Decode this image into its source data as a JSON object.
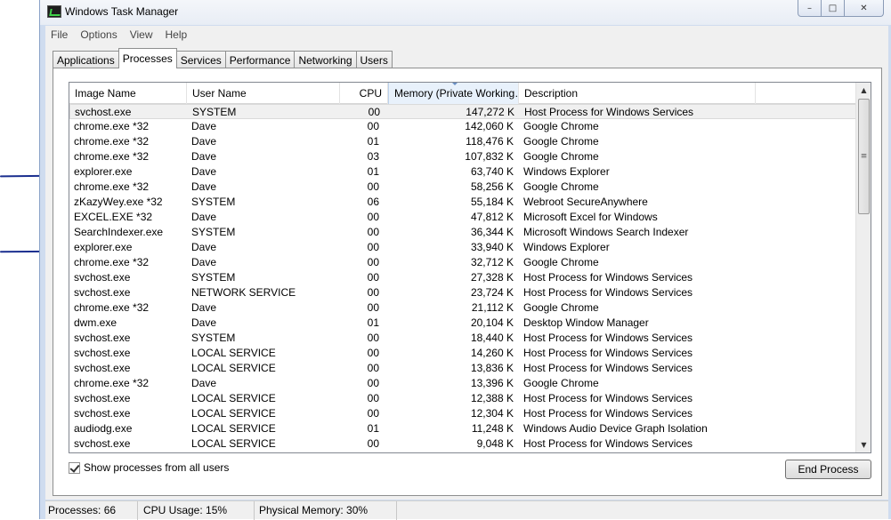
{
  "window": {
    "title": "Windows Task Manager"
  },
  "window_buttons": {
    "minimize": "–",
    "maximize": "□",
    "close": "✕"
  },
  "menu": [
    "File",
    "Options",
    "View",
    "Help"
  ],
  "tabs": [
    "Applications",
    "Processes",
    "Services",
    "Performance",
    "Networking",
    "Users"
  ],
  "active_tab": "Processes",
  "columns": [
    "Image Name",
    "User Name",
    "CPU",
    "Memory (Private Working…",
    "Description"
  ],
  "sorted_column": "Memory (Private Working…",
  "rows": [
    {
      "name": "svchost.exe",
      "user": "SYSTEM",
      "cpu": "00",
      "mem": "147,272 K",
      "desc": "Host Process for Windows Services"
    },
    {
      "name": "chrome.exe *32",
      "user": "Dave",
      "cpu": "00",
      "mem": "142,060 K",
      "desc": "Google Chrome"
    },
    {
      "name": "chrome.exe *32",
      "user": "Dave",
      "cpu": "01",
      "mem": "118,476 K",
      "desc": "Google Chrome"
    },
    {
      "name": "chrome.exe *32",
      "user": "Dave",
      "cpu": "03",
      "mem": "107,832 K",
      "desc": "Google Chrome"
    },
    {
      "name": "explorer.exe",
      "user": "Dave",
      "cpu": "01",
      "mem": "63,740 K",
      "desc": "Windows Explorer"
    },
    {
      "name": "chrome.exe *32",
      "user": "Dave",
      "cpu": "00",
      "mem": "58,256 K",
      "desc": "Google Chrome"
    },
    {
      "name": "zKazyWey.exe *32",
      "user": "SYSTEM",
      "cpu": "06",
      "mem": "55,184 K",
      "desc": "Webroot SecureAnywhere"
    },
    {
      "name": "EXCEL.EXE *32",
      "user": "Dave",
      "cpu": "00",
      "mem": "47,812 K",
      "desc": "Microsoft Excel for Windows"
    },
    {
      "name": "SearchIndexer.exe",
      "user": "SYSTEM",
      "cpu": "00",
      "mem": "36,344 K",
      "desc": "Microsoft Windows Search Indexer"
    },
    {
      "name": "explorer.exe",
      "user": "Dave",
      "cpu": "00",
      "mem": "33,940 K",
      "desc": "Windows Explorer"
    },
    {
      "name": "chrome.exe *32",
      "user": "Dave",
      "cpu": "00",
      "mem": "32,712 K",
      "desc": "Google Chrome"
    },
    {
      "name": "svchost.exe",
      "user": "SYSTEM",
      "cpu": "00",
      "mem": "27,328 K",
      "desc": "Host Process for Windows Services"
    },
    {
      "name": "svchost.exe",
      "user": "NETWORK SERVICE",
      "cpu": "00",
      "mem": "23,724 K",
      "desc": "Host Process for Windows Services"
    },
    {
      "name": "chrome.exe *32",
      "user": "Dave",
      "cpu": "00",
      "mem": "21,112 K",
      "desc": "Google Chrome"
    },
    {
      "name": "dwm.exe",
      "user": "Dave",
      "cpu": "01",
      "mem": "20,104 K",
      "desc": "Desktop Window Manager"
    },
    {
      "name": "svchost.exe",
      "user": "SYSTEM",
      "cpu": "00",
      "mem": "18,440 K",
      "desc": "Host Process for Windows Services"
    },
    {
      "name": "svchost.exe",
      "user": "LOCAL SERVICE",
      "cpu": "00",
      "mem": "14,260 K",
      "desc": "Host Process for Windows Services"
    },
    {
      "name": "svchost.exe",
      "user": "LOCAL SERVICE",
      "cpu": "00",
      "mem": "13,836 K",
      "desc": "Host Process for Windows Services"
    },
    {
      "name": "chrome.exe *32",
      "user": "Dave",
      "cpu": "00",
      "mem": "13,396 K",
      "desc": "Google Chrome"
    },
    {
      "name": "svchost.exe",
      "user": "LOCAL SERVICE",
      "cpu": "00",
      "mem": "12,388 K",
      "desc": "Host Process for Windows Services"
    },
    {
      "name": "svchost.exe",
      "user": "LOCAL SERVICE",
      "cpu": "00",
      "mem": "12,304 K",
      "desc": "Host Process for Windows Services"
    },
    {
      "name": "audiodg.exe",
      "user": "LOCAL SERVICE",
      "cpu": "01",
      "mem": "11,248 K",
      "desc": "Windows Audio Device Graph Isolation"
    },
    {
      "name": "svchost.exe",
      "user": "LOCAL SERVICE",
      "cpu": "00",
      "mem": "9,048 K",
      "desc": "Host Process for Windows Services"
    }
  ],
  "selected_row_index": 0,
  "scrollbar": {
    "up": "▲",
    "down": "▼",
    "grip": "≡"
  },
  "show_all": {
    "label": "Show processes from all users",
    "checked": true
  },
  "end_process_label": "End Process",
  "status": {
    "processes": "Processes: 66",
    "cpu": "CPU Usage: 15%",
    "memory": "Physical Memory: 30%"
  },
  "colors": {
    "ink_annotation": "#1b2f8f",
    "window_frame": "#cfdcef"
  }
}
